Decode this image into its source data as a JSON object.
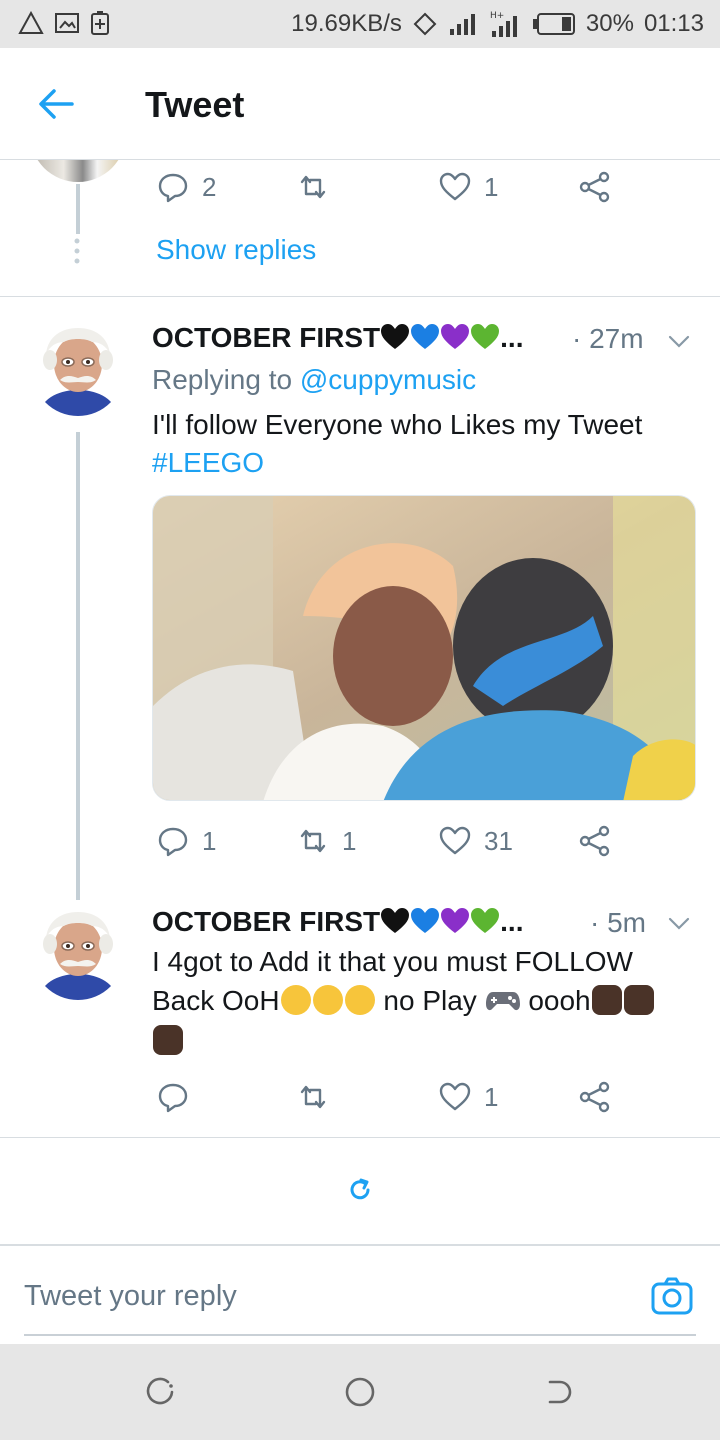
{
  "status_bar": {
    "speed": "19.69KB/s",
    "battery": "30%",
    "time": "01:13"
  },
  "header": {
    "title": "Tweet"
  },
  "previous_tweet": {
    "reply_count": "2",
    "retweet_count": "",
    "like_count": "1",
    "show_replies_label": "Show replies"
  },
  "tweets": [
    {
      "author": "OCTOBER FIRST",
      "author_suffix": "...",
      "time": "· 27m",
      "replying_prefix": "Replying to",
      "replying_handle": "@cuppymusic",
      "text_line1": "I'll follow Everyone who Likes my Tweet",
      "hashtag": "#LEEGO",
      "reply_count": "1",
      "retweet_count": "1",
      "like_count": "31"
    },
    {
      "author": "OCTOBER FIRST",
      "author_suffix": "...",
      "time": "· 5m",
      "text_line1": "I 4got to Add it that you must FOLLOW",
      "text_line2_a": "Back OoH",
      "text_line2_b": " no Play ",
      "text_line2_c": " oooh",
      "reply_count": "",
      "retweet_count": "",
      "like_count": "1"
    }
  ],
  "reply_composer": {
    "placeholder": "Tweet your reply"
  },
  "colors": {
    "accent": "#1da1f2",
    "muted": "#657786",
    "thread_line": "#c4cfd6"
  },
  "icons": [
    "back-arrow-icon",
    "reply-icon",
    "retweet-icon",
    "like-icon",
    "share-icon",
    "chevron-down-icon",
    "refresh-icon",
    "camera-icon"
  ]
}
